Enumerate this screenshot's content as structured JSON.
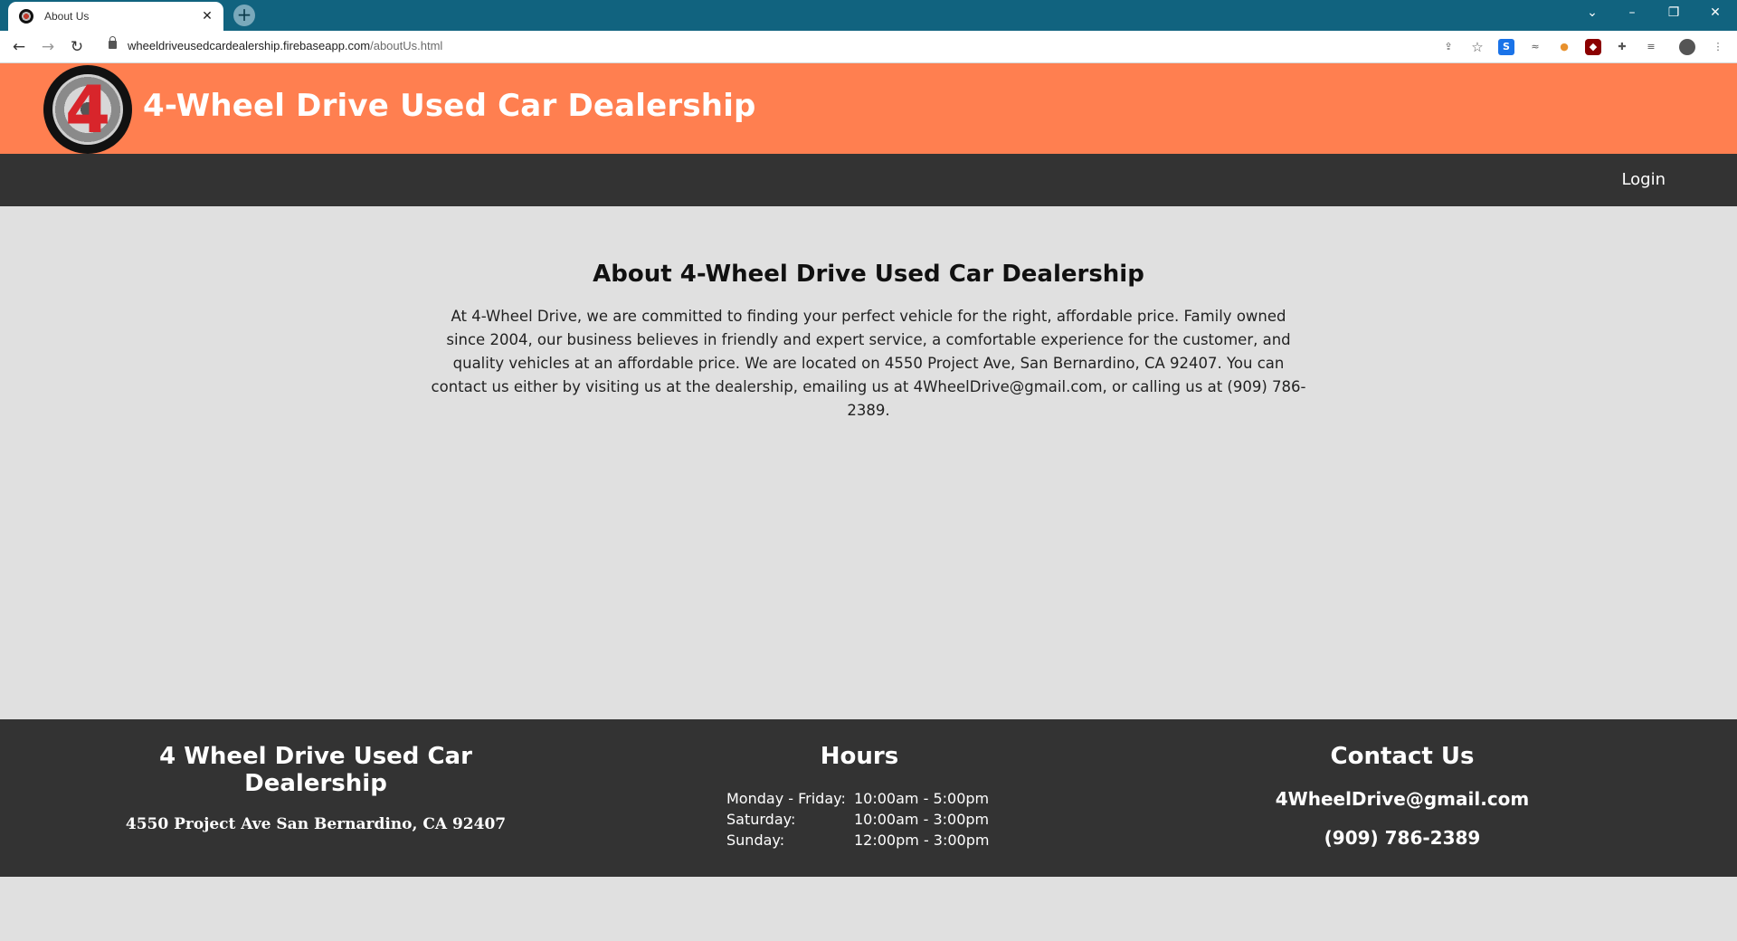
{
  "browser": {
    "tab_title": "About Us",
    "tab_close": "✕",
    "new_tab": "+",
    "url_host": "wheeldriveusedcardealership.firebaseapp.com",
    "url_path": "/aboutUs.html"
  },
  "header": {
    "logo_numeral": "4",
    "title": "4-Wheel Drive Used Car Dealership"
  },
  "nav": {
    "login": "Login"
  },
  "main": {
    "title": "About 4-Wheel Drive Used Car Dealership",
    "body": "At 4-Wheel Drive, we are committed to finding your perfect vehicle for the right, affordable price. Family owned since 2004, our business believes in friendly and expert service, a comfortable experience for the customer, and quality vehicles at an affordable price. We are located on 4550 Project Ave, San Bernardino, CA 92407. You can contact us either by visiting us at the dealership, emailing us at 4WheelDrive@gmail.com, or calling us at (909) 786-2389."
  },
  "footer": {
    "dealer_title": "4 Wheel Drive Used Car Dealership",
    "address": "4550 Project Ave San Bernardino, CA 92407",
    "hours_title": "Hours",
    "hours": [
      {
        "day": "Monday - Friday:",
        "time": "10:00am - 5:00pm"
      },
      {
        "day": "Saturday:",
        "time": "10:00am - 3:00pm"
      },
      {
        "day": "Sunday:",
        "time": "12:00pm - 3:00pm"
      }
    ],
    "contact_title": "Contact Us",
    "email": "4WheelDrive@gmail.com",
    "phone": "(909) 786-2389"
  },
  "colors": {
    "tabstrip": "#11637f",
    "header": "#ff7f50",
    "nav": "#333333",
    "page_bg": "#e0e0e0",
    "footer": "#333333"
  }
}
